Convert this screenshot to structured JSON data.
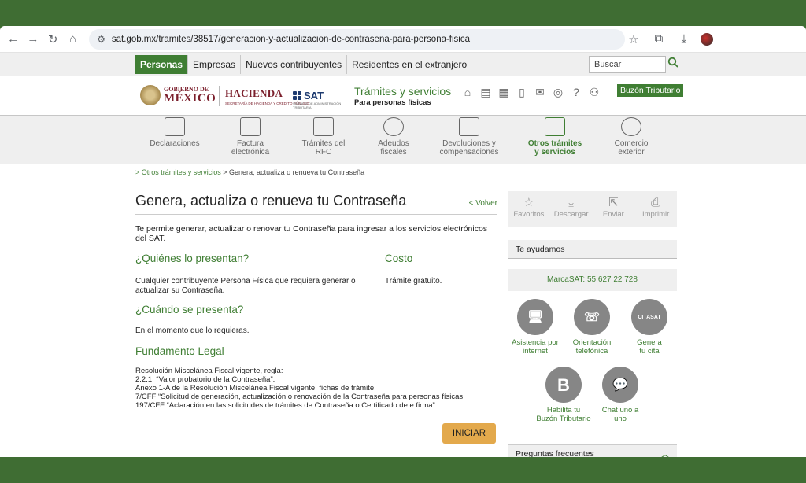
{
  "browser": {
    "url": "sat.gob.mx/tramites/38517/generacion-y-actualizacion-de-contrasena-para-persona-fisica"
  },
  "topnav": {
    "tabs": [
      "Personas",
      "Empresas",
      "Nuevos contribuyentes",
      "Residentes en el extranjero"
    ],
    "search_placeholder": "Buscar"
  },
  "header": {
    "gob_small": "GOBIERNO DE",
    "gob_big": "MÉXICO",
    "hacienda": "HACIENDA",
    "hacienda_sub": "SECRETARÍA DE HACIENDA Y CRÉDITO PÚBLICO",
    "sat": "SAT",
    "sat_sub": "SERVICIO DE ADMINISTRACIÓN TRIBUTARIA",
    "tramites_title": "Trámites y servicios",
    "tramites_sub": "Para personas físicas",
    "buzon": "Buzón Tributario"
  },
  "categories": [
    {
      "l1": "Declaraciones",
      "l2": ""
    },
    {
      "l1": "Factura",
      "l2": "electrónica"
    },
    {
      "l1": "Trámites del",
      "l2": "RFC"
    },
    {
      "l1": "Adeudos",
      "l2": "fiscales"
    },
    {
      "l1": "Devoluciones y",
      "l2": "compensaciones"
    },
    {
      "l1": "Otros trámites",
      "l2": "y servicios"
    },
    {
      "l1": "Comercio",
      "l2": "exterior"
    }
  ],
  "breadcrumb": {
    "link": "> Otros trámites y servicios",
    "current": " > Genera, actualiza o renueva tu Contraseña"
  },
  "main": {
    "title": "Genera, actualiza o renueva tu Contraseña",
    "volver": "< Volver",
    "intro": "Te permite generar, actualizar o renovar tu Contraseña para ingresar a los servicios electrónicos del SAT.",
    "quienes_h": "¿Quiénes lo presentan?",
    "quienes_p": "Cualquier contribuyente Persona Física que requiera generar o actualizar su Contraseña.",
    "costo_h": "Costo",
    "costo_p": "Trámite gratuito.",
    "cuando_h": "¿Cuándo se presenta?",
    "cuando_p": "En el momento que lo requieras.",
    "fund_h": "Fundamento Legal",
    "legal": [
      "Resolución Miscelánea Fiscal vigente, regla:",
      "2.2.1. “Valor probatorio de la Contraseña”.",
      "Anexo 1-A de la Resolución Miscelánea Fiscal vigente, fichas de trámite:",
      "7/CFF “Solicitud de generación, actualización o renovación de la Contraseña para personas físicas.",
      "197/CFF “Aclaración en las solicitudes de trámites de Contraseña o Certificado de e.firma”."
    ],
    "iniciar": "INICIAR"
  },
  "sidebar": {
    "actions": [
      "Favoritos",
      "Descargar",
      "Enviar",
      "Imprimir"
    ],
    "help_title": "Te ayudamos",
    "marca": "MarcaSAT: 55 627 22 728",
    "citasat": "CITASAT",
    "circles": [
      {
        "l1": "Asistencia por",
        "l2": "internet"
      },
      {
        "l1": "Orientación",
        "l2": "telefónica"
      },
      {
        "l1": "Genera",
        "l2": "tu cita"
      },
      {
        "l1": "Habilita tu",
        "l2": "Buzón Tributario"
      },
      {
        "l1": "Chat uno a",
        "l2": "uno"
      }
    ],
    "faq": "Preguntas frecuentes"
  }
}
